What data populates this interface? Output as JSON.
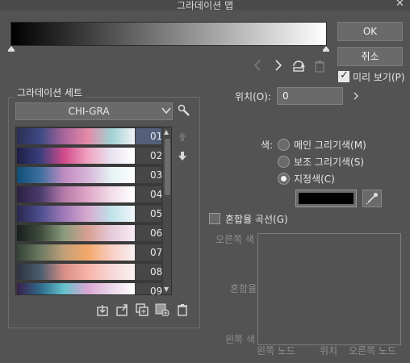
{
  "window": {
    "title": "그라데이션 맵",
    "close_glyph": "✕"
  },
  "buttons": {
    "ok": "OK",
    "cancel": "취소"
  },
  "preview": {
    "label": "미리 보기(P)",
    "checked": true
  },
  "nav_icons": {
    "prev": "chevron-left-icon",
    "next": "chevron-right-icon",
    "flip": "flip-icon",
    "delete": "trash-icon"
  },
  "gradient_set": {
    "group_label": "그라데이션 세트",
    "selected_set": "CHI-GRA",
    "items": [
      {
        "num": "01",
        "colors": [
          "#2a2f55",
          "#3d4a84",
          "#a9659a",
          "#e58aa7",
          "#9fd2d4",
          "#f3f3f6"
        ]
      },
      {
        "num": "02",
        "colors": [
          "#1d1f44",
          "#3b3f7e",
          "#d24a8a",
          "#f0a2c0",
          "#e8e3f0",
          "#ffffff"
        ]
      },
      {
        "num": "03",
        "colors": [
          "#0e4f76",
          "#3e6fa0",
          "#c08bc0",
          "#d7b5d9",
          "#e5f2f3",
          "#ffffff"
        ]
      },
      {
        "num": "04",
        "colors": [
          "#2b2040",
          "#4a3d6e",
          "#b67aa9",
          "#e0a7c6",
          "#f2dde8",
          "#ffffff"
        ]
      },
      {
        "num": "05",
        "colors": [
          "#2a2750",
          "#4d4f8f",
          "#a07ab8",
          "#d7a9d0",
          "#bfe3ea",
          "#f2f7fa"
        ]
      },
      {
        "num": "06",
        "colors": [
          "#181e1e",
          "#3f4c3c",
          "#8a9b7e",
          "#d89f92",
          "#e5c9da",
          "#f9ecf2"
        ]
      },
      {
        "num": "07",
        "colors": [
          "#324235",
          "#6d7b63",
          "#c2a078",
          "#f4a76a",
          "#f7cdc2",
          "#f8f1f2"
        ]
      },
      {
        "num": "08",
        "colors": [
          "#2d3340",
          "#4b5d70",
          "#d88f88",
          "#f7b3a6",
          "#f6d7d7",
          "#fbf1f2"
        ]
      },
      {
        "num": "09",
        "colors": [
          "#3a1f4d",
          "#2f6a8a",
          "#66c1cc",
          "#d9a7d2",
          "#ebd7ea",
          "#ffffff"
        ]
      }
    ],
    "selected_index": 0,
    "side_icons": {
      "up": "arrow-up-icon",
      "down": "arrow-down-icon"
    },
    "bottom_icons": [
      "import-icon",
      "export-icon",
      "duplicate-icon",
      "new-set-icon",
      "trash-icon"
    ]
  },
  "position": {
    "label": "위치(O):",
    "value": "0"
  },
  "color": {
    "label": "색:",
    "options": [
      "메인 그리기색(M)",
      "보조 그리기색(S)",
      "지정색(C)"
    ],
    "selected": 2,
    "swatch": "#000000"
  },
  "curve": {
    "label": "혼합율 곡선(G)",
    "checked": false,
    "y_top": "오른쪽 색",
    "y_mid": "혼합율",
    "y_bottom": "왼쪽 색",
    "x_left": "왼쪽 노드",
    "x_mid": "위치",
    "x_right": "오른쪽 노드"
  }
}
